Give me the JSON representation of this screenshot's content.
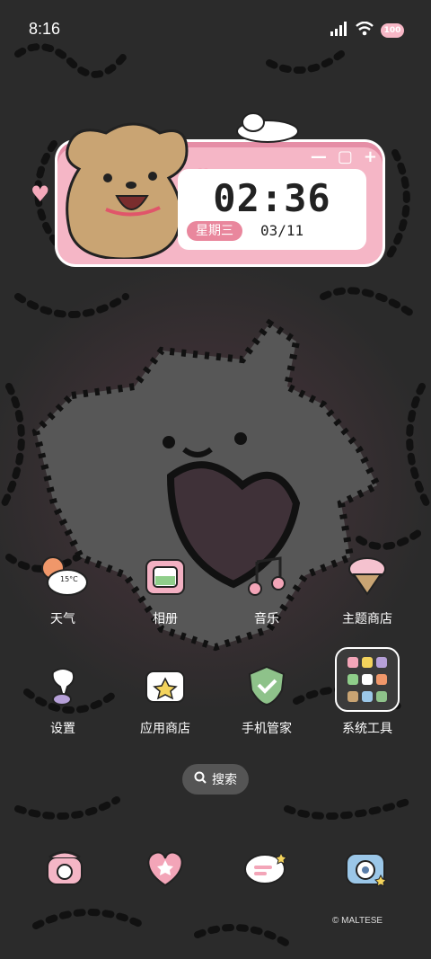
{
  "status_bar": {
    "time": "8:16",
    "battery": "100"
  },
  "clock_widget": {
    "time": "02:36",
    "weekday": "星期三",
    "date": "03/11"
  },
  "apps": [
    {
      "label": "天气",
      "icon": "weather-icon",
      "temp": "15°C"
    },
    {
      "label": "相册",
      "icon": "gallery-icon"
    },
    {
      "label": "音乐",
      "icon": "music-icon"
    },
    {
      "label": "主题商店",
      "icon": "theme-store-icon"
    },
    {
      "label": "设置",
      "icon": "settings-icon"
    },
    {
      "label": "应用商店",
      "icon": "app-store-icon"
    },
    {
      "label": "手机管家",
      "icon": "phone-manager-icon"
    },
    {
      "label": "系统工具",
      "icon": "system-tools-folder-icon"
    }
  ],
  "search": {
    "label": "搜索"
  },
  "dock": [
    {
      "icon": "phone-icon"
    },
    {
      "icon": "messages-icon"
    },
    {
      "icon": "chat-icon"
    },
    {
      "icon": "camera-icon"
    }
  ],
  "watermark": "© MALTESE"
}
